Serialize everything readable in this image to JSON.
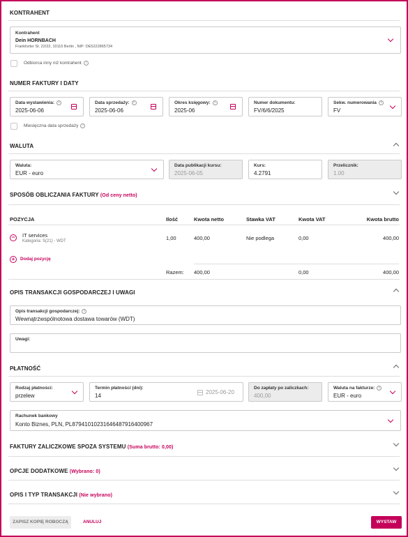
{
  "contractor": {
    "section_title": "KONTRAHENT",
    "label": "Kontrahent",
    "name": "Dein HORNBACH",
    "address": "Frankfurter St. 22/22, 10115 Berlin , NIP: DE5222865734",
    "other_recipient_label": "Odbiorca inny niż kontrahent"
  },
  "invoice_number": {
    "section_title": "NUMER FAKTURY I DATY",
    "issue_date_label": "Data wystawienia:",
    "issue_date": "2025-06-06",
    "sale_date_label": "Data sprzedaży:",
    "sale_date": "2025-06-06",
    "period_label": "Okres księgowy:",
    "period": "2025-06",
    "doc_number_label": "Numer dokumentu:",
    "doc_number": "FV/6/6/2025",
    "sequence_label": "Sekw. numerowania",
    "sequence": "FV",
    "monthly_sale_label": "Miesięczna data sprzedaży"
  },
  "currency": {
    "section_title": "WALUTA",
    "currency_label": "Waluta:",
    "currency": "EUR - euro",
    "pub_date_label": "Data publikacji kursu:",
    "pub_date": "2025-06-05",
    "rate_label": "Kurs:",
    "rate": "4.2791",
    "converter_label": "Przelicznik:",
    "converter": "1.00"
  },
  "calc_method": {
    "section_title": "SPOSÓB OBLICZANIA FAKTURY",
    "tag": "(Od ceny netto)"
  },
  "positions": {
    "headers": {
      "position": "POZYCJA",
      "qty": "Ilość",
      "net": "Kwota netto",
      "vat_rate": "Stawka VAT",
      "vat": "Kwota VAT",
      "gross": "Kwota brutto"
    },
    "item": {
      "name": "IT services",
      "category": "Kategoria: S(21) - WDT",
      "qty": "1,00",
      "net": "400,00",
      "vat_rate": "Nie podlega",
      "vat": "0,00",
      "gross": "400,00"
    },
    "add_label": "Dodaj pozycję",
    "totals": {
      "label": "Razem:",
      "net": "400,00",
      "vat": "0,00",
      "gross": "400,00"
    }
  },
  "description": {
    "section_title": "OPIS TRANSAKCJI GOSPODARCZEJ I UWAGI",
    "desc_label": "Opis transakcji gospodarczej:",
    "desc_value": "Wewnątrzwspólnotowa dostawa towarów  (WDT)",
    "notes_label": "Uwagi:"
  },
  "payment": {
    "section_title": "PŁATNOŚĆ",
    "type_label": "Rodzaj płatności:",
    "type": "przelew",
    "term_label": "Termin płatności (dni):",
    "term": "14",
    "due_date": "2025-06-20",
    "remaining_label": "Do zapłaty po zaliczkach:",
    "remaining": "400,00",
    "invoice_currency_label": "Waluta na fakturze:",
    "invoice_currency": "EUR - euro",
    "bank_label": "Rachunek bankowy",
    "bank": "Konto Biznes, PLN, PL87941010231646487916400967"
  },
  "advances": {
    "section_title": "FAKTURY ZALICZKOWE SPOZA SYSTEMU",
    "tag": "(Suma brutto: 0,00)"
  },
  "options": {
    "section_title": "OPCJE DODATKOWE",
    "tag": "(Wybrano: 0)"
  },
  "transaction_type": {
    "section_title": "OPIS I TYP TRANSAKCJI",
    "tag": "(Nie wybrano)"
  },
  "footer": {
    "draft_label": "ZAPISZ KOPIĘ ROBOCZĄ",
    "cancel_label": "ANULUJ",
    "issue_label": "WYSTAW"
  }
}
